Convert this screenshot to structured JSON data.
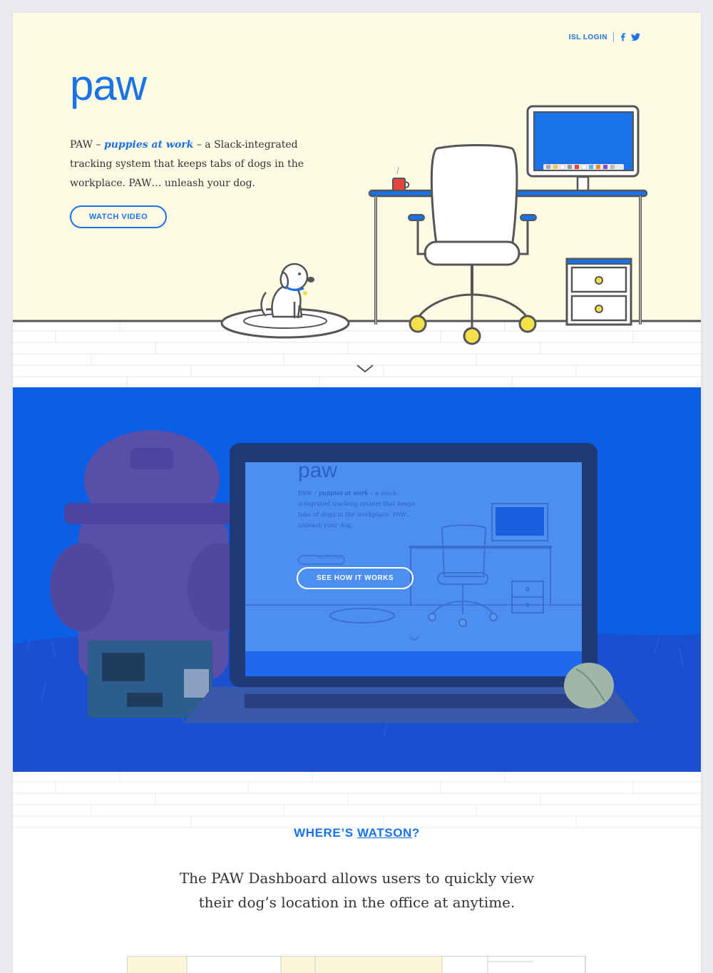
{
  "nav": {
    "login_label": "ISL LOGIN",
    "social": [
      "facebook-icon",
      "twitter-icon"
    ]
  },
  "hero": {
    "logo": "paw",
    "intro_prefix": "PAW – ",
    "intro_emphasis": "puppies at work",
    "intro_suffix": " – a Slack-integrated tracking system that keeps tabs of dogs in the workplace. PAW… unleash your dog.",
    "watch_button": "WATCH VIDEO"
  },
  "laptop_preview": {
    "logo": "paw",
    "intro_prefix": "PAW – ",
    "intro_emphasis": "puppies at work",
    "intro_suffix": " – a slack-integrated tracking system that keeps tabs of dogs in the workplace. PAW… unleash your dog.",
    "watch_button": "WATCH VIDEO"
  },
  "photo": {
    "cta_button": "SEE HOW IT WORKS"
  },
  "watson": {
    "heading_prefix": "WHERE’S ",
    "heading_link": "WATSON",
    "heading_suffix": "?",
    "description": "The PAW Dashboard allows users to quickly view their dog’s location in the office at anytime."
  },
  "colors": {
    "brand_blue": "#1a72e8",
    "hero_bg": "#fefbe4",
    "photo_overlay": "#0b5fe6",
    "accent_yellow": "#f5e04a",
    "mug_red": "#e5463b"
  }
}
